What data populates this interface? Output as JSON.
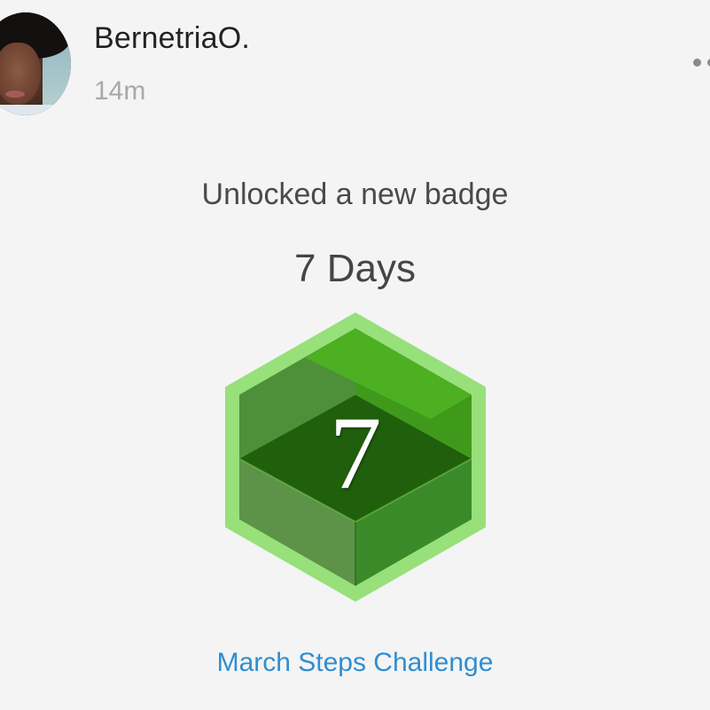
{
  "post": {
    "user_name": "BernetriaO.",
    "timestamp": "14m"
  },
  "activity": {
    "heading": "Unlocked a new badge",
    "badge_title": "7 Days",
    "badge_number": "7",
    "challenge_link": "March Steps Challenge"
  },
  "colors": {
    "badge_border": "#97e07a",
    "badge_top": "#2e7d18",
    "badge_dark": "#1d5a0c",
    "link": "#2f8ed2"
  }
}
